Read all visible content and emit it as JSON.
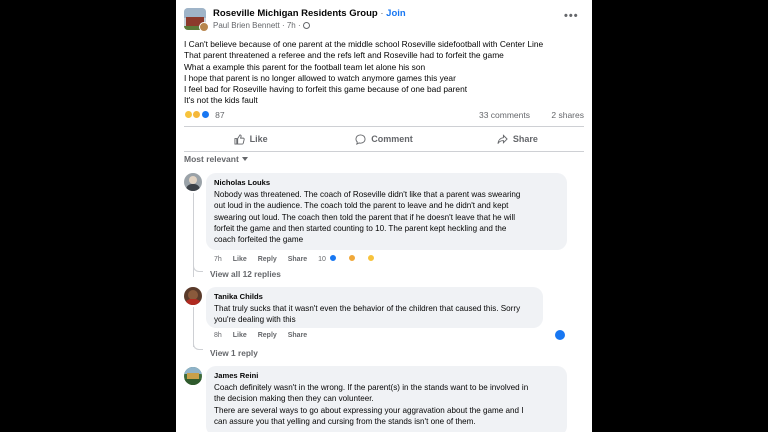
{
  "post": {
    "group_name": "Roseville Michigan Residents Group",
    "join_label": "Join",
    "author": "Paul Brien Bennett",
    "time": "7h",
    "separator": "·",
    "body_lines": [
      "I Can't believe because of one parent at the middle school Roseville sidefootball with Center Line",
      "That parent threatened a referee and the refs left and Roseville had to forfeit the game",
      "What a example this parent for the football team let alone his son",
      "I hope that parent is no longer allowed to watch anymore games this year",
      "I feel bad for Roseville having to forfeit this game because of one bad parent",
      "It's not the kids fault"
    ],
    "reaction_count": "87",
    "comments_count": "33 comments",
    "shares_count": "2 shares"
  },
  "actions": {
    "like": "Like",
    "comment": "Comment",
    "share": "Share"
  },
  "sort_label": "Most relevant",
  "comments": [
    {
      "name": "Nicholas Louks",
      "lines": [
        "Nobody was threatened. The coach of Roseville didn't like that a parent was swearing",
        "out loud in the audience. The coach told the parent to leave and he didn't and kept",
        "swearing out loud. The coach then told the parent that if he doesn't leave that he will",
        "forfeit the game and then started counting to 10. The parent kept heckling and the",
        "coach forfeited the game"
      ],
      "time": "7h",
      "like": "Like",
      "reply": "Reply",
      "share": "Share",
      "reaction_count": "10",
      "view_replies": "View all 12 replies"
    },
    {
      "name": "Tanika Childs",
      "lines": [
        "That truly sucks that it wasn't even the behavior of the children that caused this. Sorry",
        "you're dealing with this"
      ],
      "time": "8h",
      "like": "Like",
      "reply": "Reply",
      "share": "Share",
      "view_replies": "View 1 reply"
    },
    {
      "name": "James Reini",
      "lines": [
        "Coach definitely wasn't in the wrong. If the parent(s) in the stands want to be involved in",
        "the decision making then they can volunteer.",
        "There are several ways to go about expressing your aggravation about the game and I",
        "can assure you that yelling and cursing from the stands isn't one of them."
      ]
    }
  ],
  "colors": {
    "accent": "#1877f2",
    "secondary_text": "#65676b",
    "bubble": "#f0f2f5"
  },
  "icons": [
    "globe-icon",
    "more-icon",
    "like-icon",
    "comment-icon",
    "share-icon",
    "caret-down-icon"
  ]
}
